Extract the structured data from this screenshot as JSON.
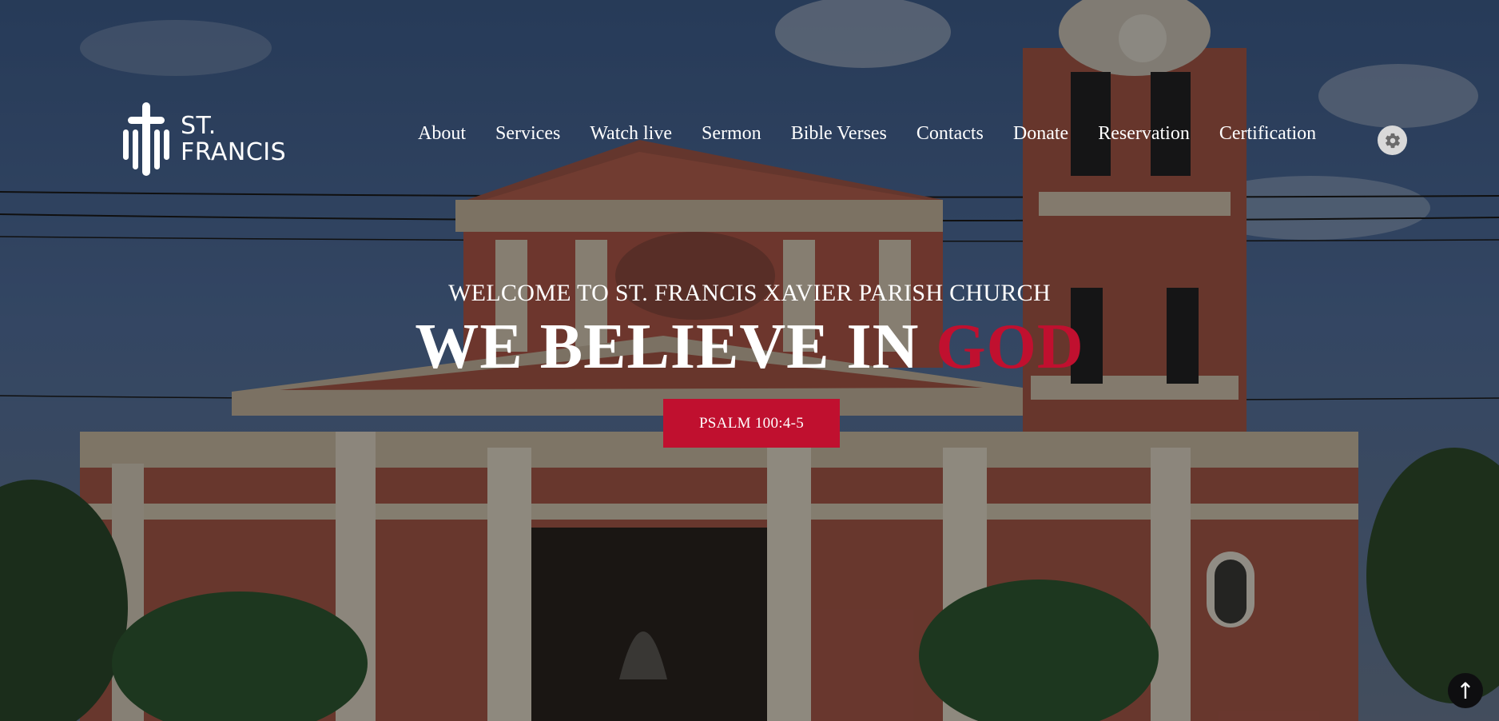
{
  "brand": {
    "line1": "ST.",
    "line2": "FRANCIS",
    "logo_icon": "cross-barcode-icon"
  },
  "nav": {
    "items": [
      "About",
      "Services",
      "Watch live",
      "Sermon",
      "Bible Verses",
      "Contacts",
      "Donate",
      "Reservation",
      "Certification"
    ],
    "settings_icon": "gear-icon"
  },
  "hero": {
    "welcome": "WELCOME TO ST. FRANCIS XAVIER PARISH CHURCH",
    "headline_main": "WE BELIEVE IN ",
    "headline_accent": "GOD",
    "cta_label": "PSALM 100:4-5",
    "background": "church-facade-photo"
  },
  "scroll_top": {
    "icon": "arrow-up-icon",
    "glyph": "↑"
  },
  "colors": {
    "accent": "#c0102f",
    "text": "#ffffff"
  }
}
